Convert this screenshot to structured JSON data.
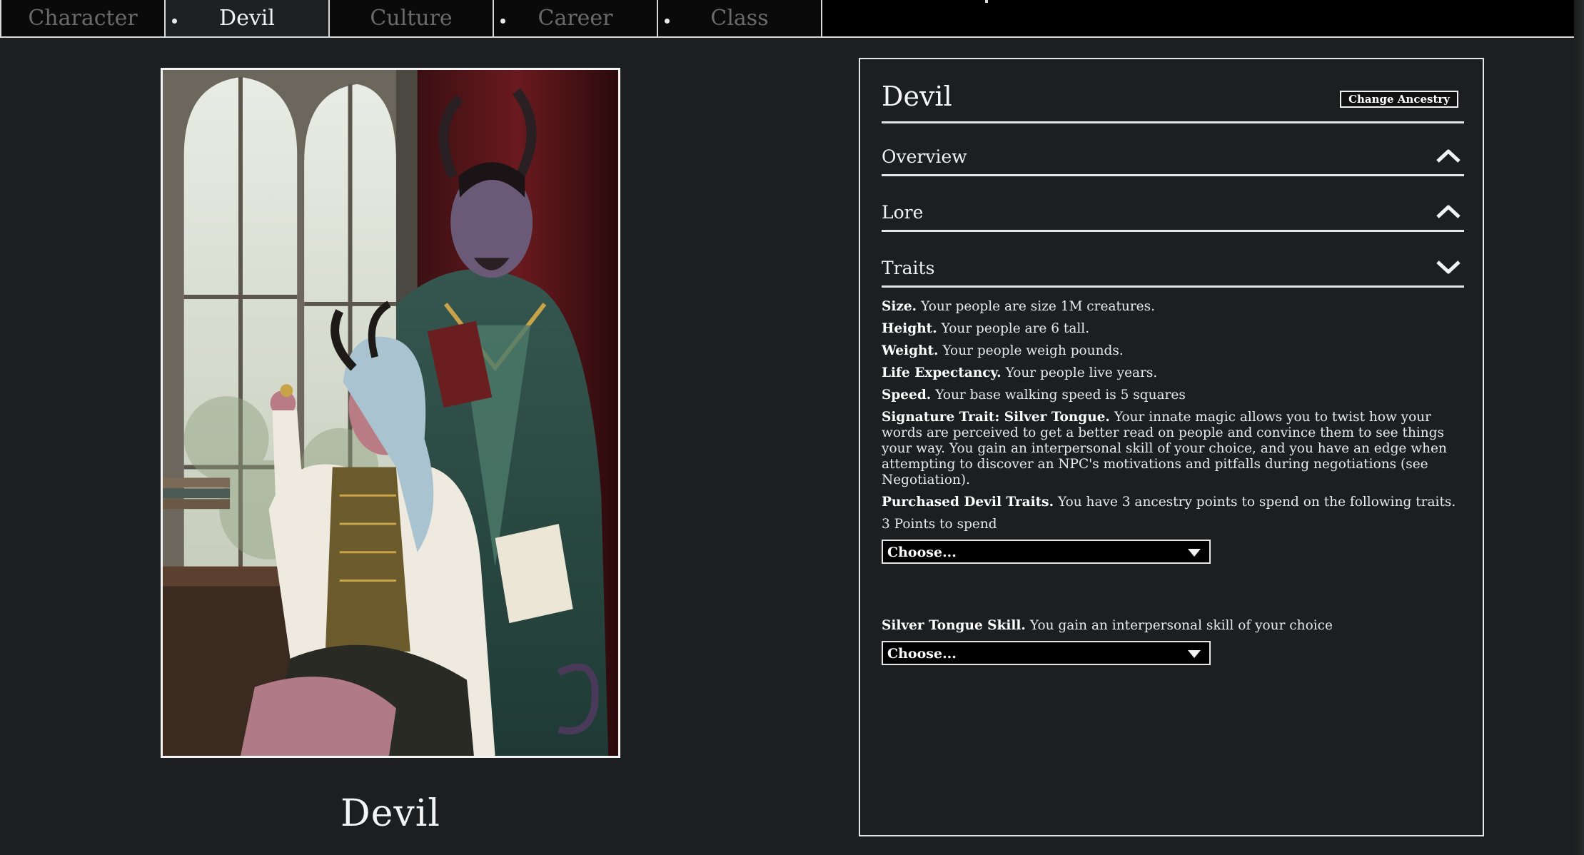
{
  "tabs": [
    {
      "label": "Character",
      "active": false,
      "dot": false
    },
    {
      "label": "Devil",
      "active": true,
      "dot": true
    },
    {
      "label": "Culture",
      "active": false,
      "dot": false
    },
    {
      "label": "Career",
      "active": false,
      "dot": true
    },
    {
      "label": "Class",
      "active": false,
      "dot": true
    }
  ],
  "portrait": {
    "caption": "Devil"
  },
  "panel": {
    "title": "Devil",
    "change_button": "Change Ancestry",
    "sections": [
      {
        "label": "Overview",
        "icon": "chevron-up-icon"
      },
      {
        "label": "Lore",
        "icon": "chevron-up-icon"
      },
      {
        "label": "Traits",
        "icon": "chevron-down-icon"
      }
    ],
    "traits": [
      {
        "name": "Size.",
        "text": "Your people are size 1M creatures."
      },
      {
        "name": "Height.",
        "text": "Your people are 6 tall."
      },
      {
        "name": "Weight.",
        "text": "Your people weigh  pounds."
      },
      {
        "name": "Life Expectancy.",
        "text": "Your people live  years."
      },
      {
        "name": "Speed.",
        "text": "Your base walking speed is 5 squares"
      },
      {
        "name": "Signature Trait: Silver Tongue.",
        "text": "Your innate magic allows you to twist how your words are perceived to get a better read on people and convince them to see things your way. You gain an interpersonal skill of your choice, and you have an edge when attempting to discover an NPC's motivations and pitfalls during negotiations (see Negotiation)."
      },
      {
        "name": "Purchased Devil Traits.",
        "text": "You have 3 ancestry points to spend on the following traits."
      }
    ],
    "points_text": "3 Points to spend",
    "trait_select": "Choose...",
    "skill": {
      "name": "Silver Tongue Skill.",
      "text": "You gain an interpersonal skill of your choice",
      "select": "Choose..."
    }
  }
}
